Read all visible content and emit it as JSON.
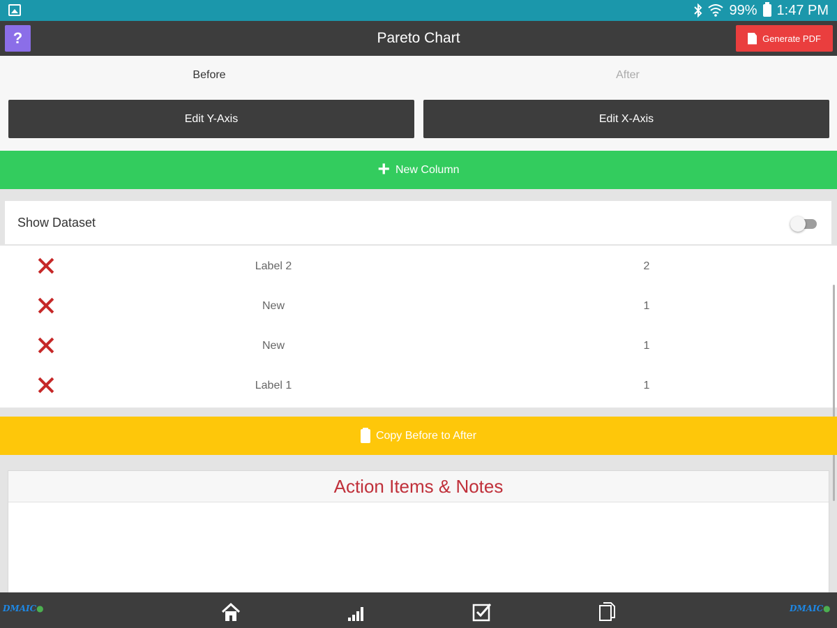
{
  "status": {
    "battery": "99%",
    "time": "1:47 PM"
  },
  "header": {
    "help_label": "?",
    "title": "Pareto Chart",
    "pdf_label": "Generate PDF"
  },
  "tabs": [
    {
      "label": "Before",
      "active": true
    },
    {
      "label": "After",
      "active": false
    }
  ],
  "axis": {
    "y_label": "Edit Y-Axis",
    "x_label": "Edit X-Axis"
  },
  "new_column_label": "New Column",
  "dataset": {
    "label": "Show Dataset",
    "enabled": false
  },
  "rows": [
    {
      "label": "Label 2",
      "value": "2"
    },
    {
      "label": "New",
      "value": "1"
    },
    {
      "label": "New",
      "value": "1"
    },
    {
      "label": "Label 1",
      "value": "1"
    }
  ],
  "copy_label": "Copy Before to After",
  "notes": {
    "title": "Action Items & Notes",
    "content": ""
  },
  "bottom_nav": {
    "logo_text": "DMAIC",
    "items": [
      {
        "icon": "home-icon"
      },
      {
        "icon": "signal-bars-icon"
      },
      {
        "icon": "checkbox-icon"
      },
      {
        "icon": "documents-icon"
      }
    ]
  },
  "colors": {
    "status_bar": "#1b97ab",
    "header": "#3d3d3d",
    "help": "#8b6ee8",
    "pdf": "#ea3e3e",
    "new_column": "#33cc5e",
    "copy": "#fec70a",
    "delete": "#c62828",
    "notes_title": "#c0303a"
  }
}
